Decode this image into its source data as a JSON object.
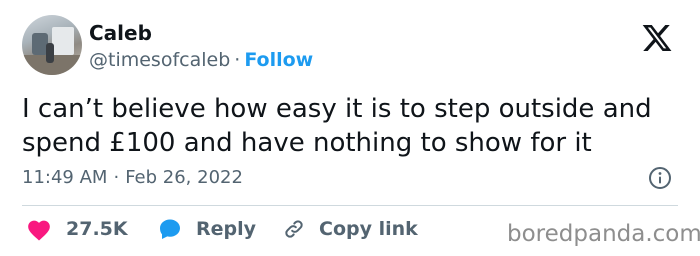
{
  "author": {
    "name": "Caleb",
    "handle": "@timesofcaleb",
    "separator": "·",
    "follow_label": "Follow"
  },
  "tweet": {
    "text_line1": "I can’t believe how easy it is to step outside and",
    "text_line2": "spend £100 and have nothing to show for it",
    "time": "11:49 AM",
    "separator": "·",
    "date": "Feb 26, 2022"
  },
  "actions": {
    "likes": "27.5K",
    "reply_label": "Reply",
    "copy_label": "Copy link"
  },
  "watermark": "boredpanda.com",
  "icons": {
    "logo": "x-logo-icon",
    "info": "info-icon",
    "like": "heart-icon",
    "reply": "speech-bubble-icon",
    "copy": "link-icon"
  },
  "colors": {
    "link": "#1d9bf0",
    "heart": "#f91880",
    "muted": "#536471",
    "text": "#0f1419"
  }
}
